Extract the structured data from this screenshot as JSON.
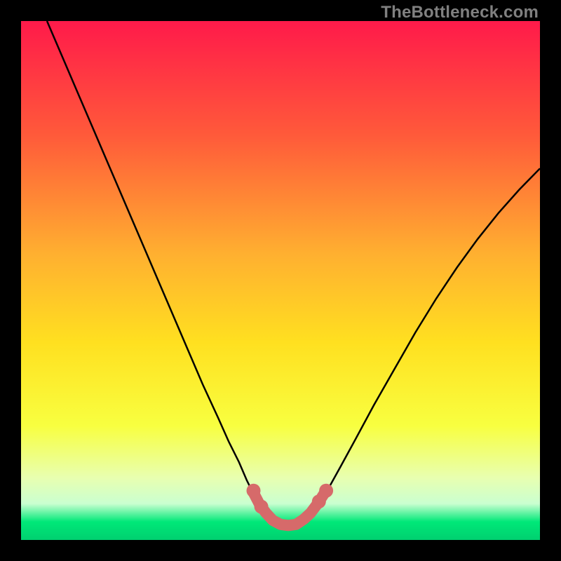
{
  "attribution": "TheBottleneck.com",
  "chart_data": {
    "type": "line",
    "title": "",
    "xlabel": "",
    "ylabel": "",
    "xlim": [
      0,
      1
    ],
    "ylim": [
      0,
      1
    ],
    "gradient_stops": [
      {
        "offset": 0.0,
        "color": "#ff1a4a"
      },
      {
        "offset": 0.22,
        "color": "#ff5a3a"
      },
      {
        "offset": 0.45,
        "color": "#ffb030"
      },
      {
        "offset": 0.62,
        "color": "#ffe020"
      },
      {
        "offset": 0.78,
        "color": "#f8ff40"
      },
      {
        "offset": 0.88,
        "color": "#e8ffb0"
      },
      {
        "offset": 0.93,
        "color": "#caffd0"
      },
      {
        "offset": 0.965,
        "color": "#00e878"
      },
      {
        "offset": 1.0,
        "color": "#00d070"
      }
    ],
    "series": [
      {
        "name": "v-curve",
        "stroke": "#000000",
        "stroke_width": 2.5,
        "points": [
          {
            "x": 0.05,
            "y": 1.0
          },
          {
            "x": 0.08,
            "y": 0.93
          },
          {
            "x": 0.11,
            "y": 0.86
          },
          {
            "x": 0.14,
            "y": 0.79
          },
          {
            "x": 0.17,
            "y": 0.72
          },
          {
            "x": 0.2,
            "y": 0.65
          },
          {
            "x": 0.23,
            "y": 0.58
          },
          {
            "x": 0.26,
            "y": 0.51
          },
          {
            "x": 0.29,
            "y": 0.44
          },
          {
            "x": 0.32,
            "y": 0.37
          },
          {
            "x": 0.35,
            "y": 0.3
          },
          {
            "x": 0.38,
            "y": 0.235
          },
          {
            "x": 0.4,
            "y": 0.19
          },
          {
            "x": 0.42,
            "y": 0.15
          },
          {
            "x": 0.435,
            "y": 0.115
          },
          {
            "x": 0.45,
            "y": 0.085
          },
          {
            "x": 0.465,
            "y": 0.06
          },
          {
            "x": 0.48,
            "y": 0.045
          },
          {
            "x": 0.495,
            "y": 0.032
          },
          {
            "x": 0.51,
            "y": 0.028
          },
          {
            "x": 0.525,
            "y": 0.028
          },
          {
            "x": 0.54,
            "y": 0.032
          },
          {
            "x": 0.555,
            "y": 0.046
          },
          {
            "x": 0.57,
            "y": 0.065
          },
          {
            "x": 0.59,
            "y": 0.095
          },
          {
            "x": 0.615,
            "y": 0.14
          },
          {
            "x": 0.645,
            "y": 0.195
          },
          {
            "x": 0.68,
            "y": 0.26
          },
          {
            "x": 0.72,
            "y": 0.33
          },
          {
            "x": 0.76,
            "y": 0.4
          },
          {
            "x": 0.8,
            "y": 0.465
          },
          {
            "x": 0.84,
            "y": 0.525
          },
          {
            "x": 0.88,
            "y": 0.58
          },
          {
            "x": 0.92,
            "y": 0.63
          },
          {
            "x": 0.96,
            "y": 0.675
          },
          {
            "x": 1.0,
            "y": 0.716
          }
        ]
      },
      {
        "name": "marker-overlay",
        "stroke": "#d66a6a",
        "stroke_width": 16,
        "points": [
          {
            "x": 0.447,
            "y": 0.093
          },
          {
            "x": 0.46,
            "y": 0.068
          },
          {
            "x": 0.472,
            "y": 0.052
          },
          {
            "x": 0.485,
            "y": 0.038
          },
          {
            "x": 0.5,
            "y": 0.03
          },
          {
            "x": 0.515,
            "y": 0.028
          },
          {
            "x": 0.53,
            "y": 0.03
          },
          {
            "x": 0.545,
            "y": 0.04
          },
          {
            "x": 0.558,
            "y": 0.052
          },
          {
            "x": 0.573,
            "y": 0.072
          },
          {
            "x": 0.586,
            "y": 0.092
          }
        ],
        "dots": [
          {
            "x": 0.448,
            "y": 0.095,
            "r": 10
          },
          {
            "x": 0.463,
            "y": 0.064,
            "r": 10
          },
          {
            "x": 0.574,
            "y": 0.074,
            "r": 10
          },
          {
            "x": 0.588,
            "y": 0.095,
            "r": 10
          }
        ]
      }
    ]
  }
}
